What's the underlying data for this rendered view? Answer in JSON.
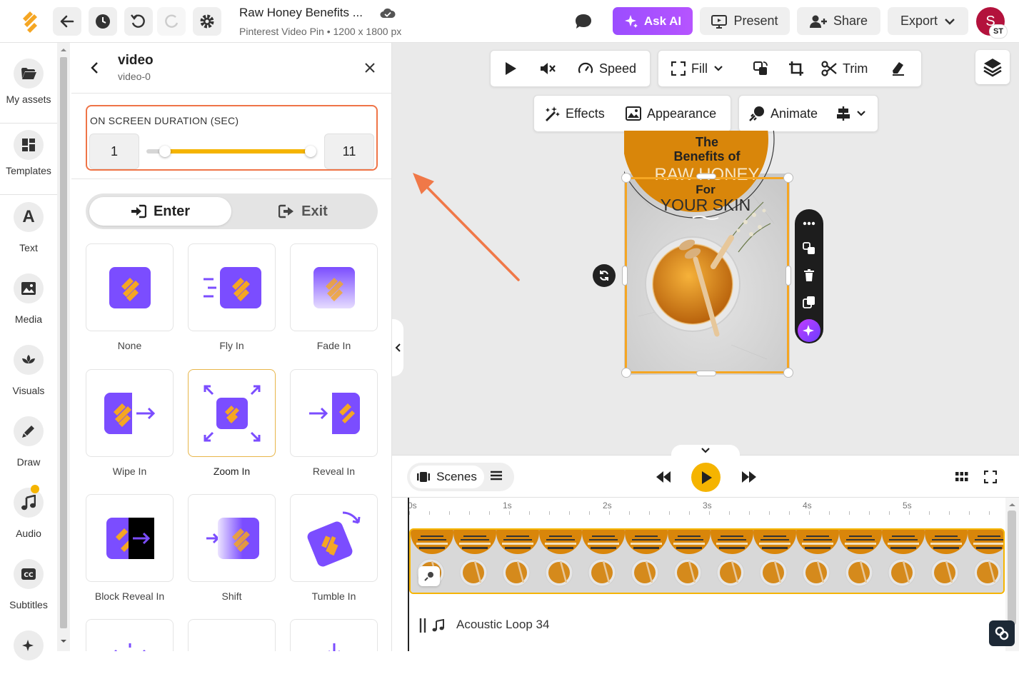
{
  "header": {
    "doc_title": "Raw Honey Benefits ...",
    "doc_subtitle": "Pinterest Video Pin • 1200 x 1800 px",
    "ask_ai_label": "Ask AI",
    "present_label": "Present",
    "share_label": "Share",
    "export_label": "Export",
    "avatar_initial": "S",
    "avatar_badge": "ST"
  },
  "rail": {
    "items": [
      {
        "label": "My assets",
        "icon": "folder-icon"
      },
      {
        "label": "Templates",
        "icon": "templates-icon"
      },
      {
        "label": "Text",
        "icon": "text-icon"
      },
      {
        "label": "Media",
        "icon": "image-icon"
      },
      {
        "label": "Visuals",
        "icon": "visuals-icon"
      },
      {
        "label": "Draw",
        "icon": "pen-icon"
      },
      {
        "label": "Audio",
        "icon": "music-icon"
      },
      {
        "label": "Subtitles",
        "icon": "cc-icon"
      }
    ]
  },
  "panel": {
    "title": "video",
    "subtitle": "video-0",
    "duration_label": "ON SCREEN DURATION (SEC)",
    "duration_min": "1",
    "duration_max": "11",
    "enter_label": "Enter",
    "exit_label": "Exit",
    "animations": [
      "None",
      "Fly In",
      "Fade In",
      "Wipe In",
      "Zoom In",
      "Reveal In",
      "Block Reveal In",
      "Shift",
      "Tumble In"
    ],
    "selected_animation": "Zoom In"
  },
  "canvas_toolbar": {
    "speed_label": "Speed",
    "fill_label": "Fill",
    "trim_label": "Trim",
    "effects_label": "Effects",
    "appearance_label": "Appearance",
    "animate_label": "Animate"
  },
  "design": {
    "line1": "The",
    "line2": "Benefits of",
    "line3": "RAW HONEY",
    "line4": "For",
    "line5": "YOUR SKIN"
  },
  "timeline": {
    "scenes_label": "Scenes",
    "ruler": [
      "0s",
      "1s",
      "2s",
      "3s",
      "4s",
      "5s"
    ],
    "audio_track": "Acoustic Loop 34"
  },
  "colors": {
    "accent": "#f5b400",
    "brand_purple": "#7b4dff",
    "highlight": "#ef7447"
  }
}
